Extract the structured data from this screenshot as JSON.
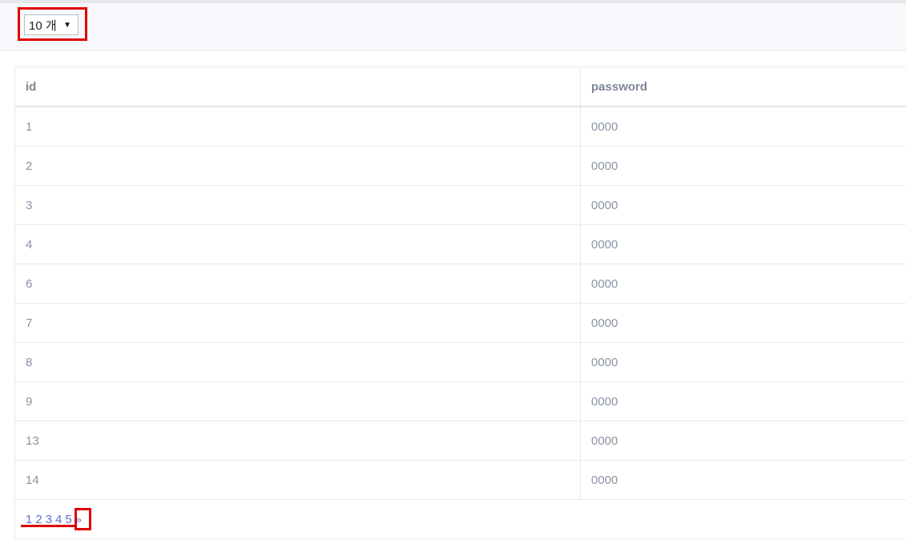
{
  "page_size_select": {
    "value": "10 개",
    "caret": "▼"
  },
  "table": {
    "headers": [
      "id",
      "password"
    ],
    "rows": [
      [
        "1",
        "0000"
      ],
      [
        "2",
        "0000"
      ],
      [
        "3",
        "0000"
      ],
      [
        "4",
        "0000"
      ],
      [
        "6",
        "0000"
      ],
      [
        "7",
        "0000"
      ],
      [
        "8",
        "0000"
      ],
      [
        "9",
        "0000"
      ],
      [
        "13",
        "0000"
      ],
      [
        "14",
        "0000"
      ]
    ]
  },
  "pagination": {
    "pages": [
      "1",
      "2",
      "3",
      "4",
      "5"
    ],
    "next_label": "»"
  },
  "colors": {
    "annotation_red": "#e00000",
    "link_blue": "#5d6fc9",
    "cell_text": "#8a93a3"
  }
}
